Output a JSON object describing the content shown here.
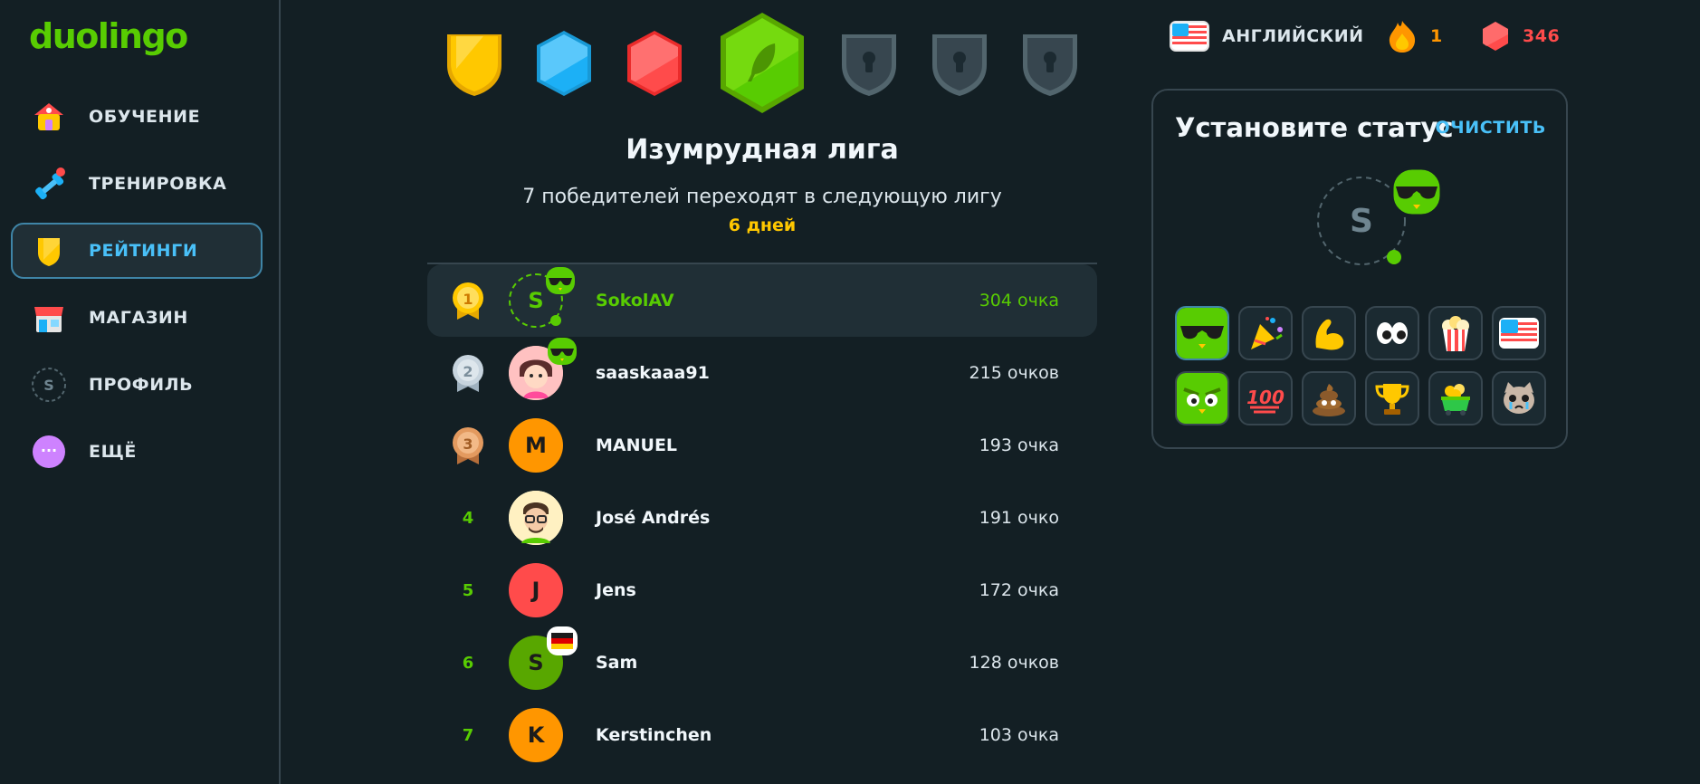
{
  "app": {
    "logo": "duolingo"
  },
  "sidebar": {
    "items": [
      {
        "label": "ОБУЧЕНИЕ",
        "icon": "home-icon"
      },
      {
        "label": "ТРЕНИРОВКА",
        "icon": "dumbbell-icon"
      },
      {
        "label": "РЕЙТИНГИ",
        "icon": "shield-icon",
        "active": true
      },
      {
        "label": "МАГАЗИН",
        "icon": "shop-icon"
      },
      {
        "label": "ПРОФИЛЬ",
        "icon": "profile-icon",
        "initial": "S"
      },
      {
        "label": "ЕЩЁ",
        "icon": "more-icon",
        "glyph": "···"
      }
    ]
  },
  "league": {
    "title": "Изумрудная лига",
    "subtitle": "7 победителей переходят в следующую лигу",
    "days": "6 дней"
  },
  "leaderboard": [
    {
      "rank": "1",
      "name": "SokolAV",
      "points": "304 очка",
      "initial": "S",
      "me": true
    },
    {
      "rank": "2",
      "name": "saaskaaa91",
      "points": "215 очков"
    },
    {
      "rank": "3",
      "name": "MANUEL",
      "points": "193 очка",
      "initial": "M"
    },
    {
      "rank": "4",
      "name": "José Andrés",
      "points": "191 очко"
    },
    {
      "rank": "5",
      "name": "Jens",
      "points": "172 очка",
      "initial": "J"
    },
    {
      "rank": "6",
      "name": "Sam",
      "points": "128 очков",
      "initial": "S"
    },
    {
      "rank": "7",
      "name": "Kerstinchen",
      "points": "103 очка",
      "initial": "K"
    }
  ],
  "topbar": {
    "course": "АНГЛИЙСКИЙ",
    "streak": "1",
    "gems": "346"
  },
  "status": {
    "title": "Установите статус",
    "clear": "ОЧИСТИТЬ",
    "avatar_initial": "S",
    "emojis": [
      "sunglasses-owl",
      "party-popper",
      "flexed-biceps",
      "eyes",
      "popcorn",
      "us-flag",
      "angry-owl",
      "hundred-points",
      "pile-of-poo",
      "trophy",
      "money-cart",
      "crying-cat"
    ]
  },
  "colors": {
    "background": "#131f24",
    "accent_green": "#58cc02",
    "accent_blue": "#49c0f8",
    "gold": "#ffc800",
    "gem_red": "#ff4b4b",
    "streak_orange": "#ff9600"
  }
}
